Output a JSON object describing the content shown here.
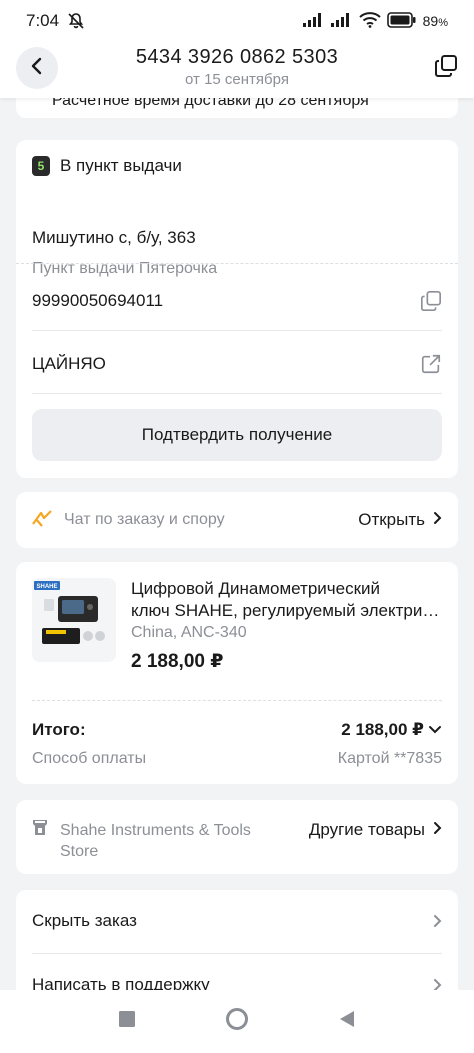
{
  "status_bar": {
    "time": "7:04",
    "battery": "89",
    "battery_unit": "%"
  },
  "header": {
    "order_number": "5434 3926 0862 5303",
    "order_date": "от 15 сентября"
  },
  "delivery_note": "Расчетное время доставки до 28 сентября",
  "pickup": {
    "badge": "5",
    "type_label": "В пункт выдачи",
    "address": "Мишутино с, б/у, 363",
    "point_name": "Пункт выдачи Пятерочка",
    "tracking_number": "99990050694011",
    "carrier": "ЦАЙНЯО",
    "confirm_label": "Подтвердить получение"
  },
  "chat": {
    "label": "Чат по заказу и спору",
    "action": "Открыть"
  },
  "product": {
    "thumb_brand": "SHAHE",
    "name_line1": "Цифровой Динамометрический",
    "name_line2": "ключ SHAHE, регулируемый электрический",
    "variant": "China, ANC-340",
    "price": "2 188,00 ₽"
  },
  "summary": {
    "total_label": "Итого:",
    "total_value": "2 188,00 ₽",
    "payment_label": "Способ оплаты",
    "payment_value": "Картой **7835"
  },
  "store": {
    "name": "Shahe Instruments & Tools Store",
    "action": "Другие товары"
  },
  "menu": {
    "hide_order": "Скрыть заказ",
    "write_support": "Написать в поддержку"
  },
  "colors": {
    "accent_orange": "#f5a623",
    "muted_text": "#8c8f96",
    "button_bg": "#eceef2"
  }
}
